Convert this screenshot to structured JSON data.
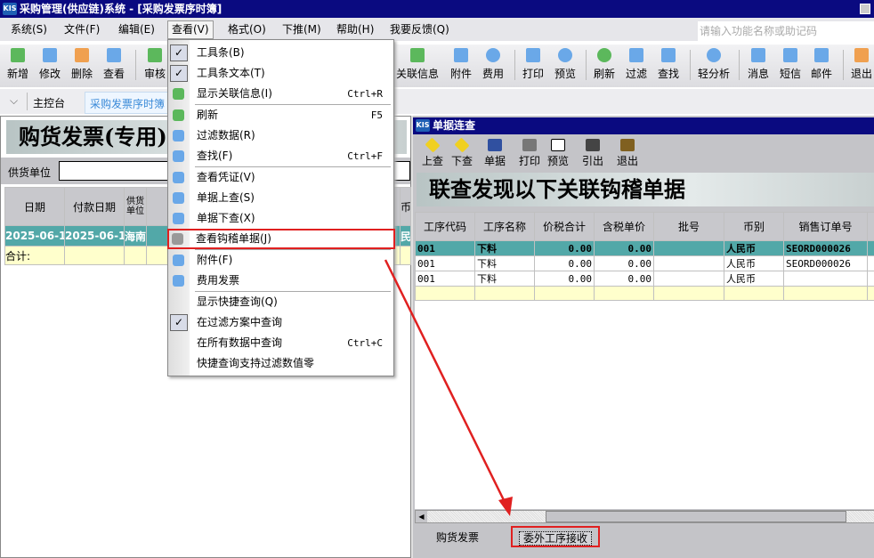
{
  "window": {
    "title": "采购管理(供应链)系统 - [采购发票序时簿]",
    "logo": "KIS"
  },
  "menubar": {
    "items": [
      "系统(S)",
      "文件(F)",
      "编辑(E)",
      "查看(V)",
      "格式(O)",
      "下推(M)",
      "帮助(H)",
      "我要反馈(Q)"
    ],
    "search_placeholder": "请输入功能名称或助记码"
  },
  "toolbar": {
    "left": [
      "新增",
      "修改",
      "删除",
      "查看",
      "审核"
    ],
    "right": [
      "关联信息",
      "附件",
      "费用",
      "打印",
      "预览",
      "刷新",
      "过滤",
      "查找",
      "轻分析",
      "消息",
      "短信",
      "邮件",
      "退出"
    ]
  },
  "tabs": {
    "home": "主控台",
    "active": "采购发票序时簿"
  },
  "leftpane": {
    "banner": "购货发票(专用)",
    "filter_label": "供货单位",
    "columns": [
      "日期",
      "付款日期",
      "供货单位",
      "",
      "币"
    ],
    "selected_row": [
      "2025-06-1:",
      "2025-06-1:",
      "海南",
      "",
      "民"
    ],
    "total_label": "合计:"
  },
  "view_menu": {
    "items": [
      {
        "label": "工具条(B)",
        "checked": true,
        "shortcut": ""
      },
      {
        "label": "工具条文本(T)",
        "checked": true,
        "shortcut": ""
      },
      {
        "label": "显示关联信息(I)",
        "icon": "relation-icon",
        "shortcut": "Ctrl+R"
      },
      {
        "label": "刷新",
        "icon": "refresh-icon",
        "shortcut": "F5"
      },
      {
        "label": "过滤数据(R)",
        "icon": "filter-icon",
        "shortcut": ""
      },
      {
        "label": "查找(F)",
        "icon": "binoculars-icon",
        "shortcut": "Ctrl+F"
      },
      {
        "label": "查看凭证(V)",
        "icon": "voucher-icon",
        "shortcut": ""
      },
      {
        "label": "单据上查(S)",
        "icon": "lookup-up-icon",
        "shortcut": ""
      },
      {
        "label": "单据下查(X)",
        "icon": "lookup-down-icon",
        "shortcut": ""
      },
      {
        "label": "查看钩稽单据(J)",
        "icon": "hook-icon",
        "shortcut": "",
        "highlighted": true
      },
      {
        "label": "附件(F)",
        "icon": "attachment-icon",
        "shortcut": ""
      },
      {
        "label": "费用发票",
        "icon": "money-bag-icon",
        "shortcut": ""
      },
      {
        "label": "显示快捷查询(Q)",
        "shortcut": ""
      },
      {
        "label": "在过滤方案中查询",
        "checked": true,
        "shortcut": ""
      },
      {
        "label": "在所有数据中查询",
        "shortcut": "Ctrl+C"
      },
      {
        "label": "快捷查询支持过滤数值零",
        "shortcut": ""
      }
    ]
  },
  "child": {
    "title": "单据连查",
    "toolbar": [
      "上查",
      "下查",
      "单据",
      "打印",
      "预览",
      "引出",
      "退出"
    ],
    "banner": "联查发现以下关联钩稽单据",
    "columns": [
      "工序代码",
      "工序名称",
      "价税合计",
      "含税单价",
      "批号",
      "币别",
      "销售订单号"
    ],
    "rows": [
      [
        "001",
        "下料",
        "0.00",
        "0.00",
        "",
        "人民币",
        "SEORD000026"
      ],
      [
        "001",
        "下料",
        "0.00",
        "0.00",
        "",
        "人民币",
        "SEORD000026"
      ],
      [
        "001",
        "下料",
        "0.00",
        "0.00",
        "",
        "人民币",
        ""
      ]
    ],
    "bottom_tabs": [
      "购货发票",
      "委外工序接收"
    ]
  },
  "colors": {
    "title": "#0a0a80",
    "selected_row": "#52a8a8",
    "total_row": "#ffffcc",
    "highlight": "#e02020"
  }
}
